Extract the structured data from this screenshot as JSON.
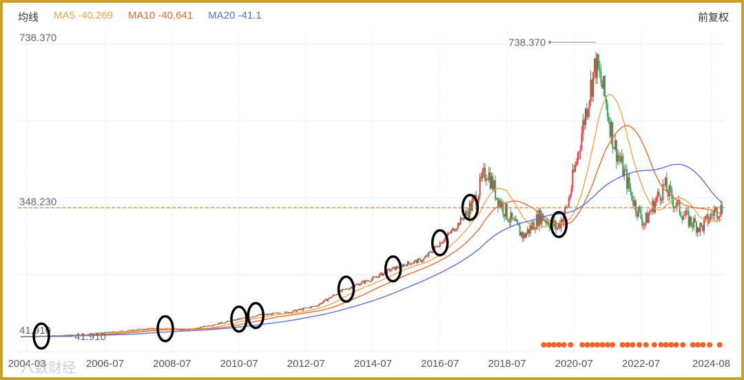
{
  "header": {
    "indicator_label": "均线",
    "ma5_label": "MA5 -40.269",
    "ma10_label": "MA10 -40.641",
    "ma20_label": "MA20 -41.1",
    "adjust_label": "前复权"
  },
  "colors": {
    "up": "#e8383b",
    "down": "#21a95c",
    "ma5": "#f0a64a",
    "ma10": "#ea6a2c",
    "ma20": "#5a6fd8",
    "dashed_line": "#ea7a30",
    "event_dot": "#f0642a",
    "circle": "#000000",
    "frame": "#c9a12a"
  },
  "watermark": "八数财经",
  "chart_data": {
    "type": "candlestick",
    "title": "",
    "xlabel": "",
    "ylabel": "",
    "y_ticks": [
      "738.370",
      "348.230",
      "41.910"
    ],
    "y_tick_values": [
      738.37,
      348.23,
      41.91
    ],
    "max_label": "738.370",
    "start_label": "41.910",
    "current_price_line": 348.23,
    "x_ticks": [
      "2004-03",
      "2006-07",
      "2008-07",
      "2010-07",
      "2012-07",
      "2014-07",
      "2016-07",
      "2018-07",
      "2020-07",
      "2022-07",
      "2024-08"
    ],
    "x_tick_years": [
      2004.17,
      2006.5,
      2008.5,
      2010.5,
      2012.5,
      2014.5,
      2016.5,
      2018.5,
      2020.5,
      2022.5,
      2024.6
    ],
    "x_range": [
      2003.9,
      2025.0
    ],
    "y_range": [
      6,
      770
    ],
    "price_path": [
      [
        2004.0,
        42
      ],
      [
        2005.0,
        44
      ],
      [
        2006.0,
        48
      ],
      [
        2007.0,
        55
      ],
      [
        2008.0,
        62
      ],
      [
        2009.0,
        58
      ],
      [
        2010.0,
        75
      ],
      [
        2011.0,
        92
      ],
      [
        2012.0,
        100
      ],
      [
        2012.8,
        115
      ],
      [
        2013.5,
        148
      ],
      [
        2014.0,
        165
      ],
      [
        2014.5,
        180
      ],
      [
        2015.0,
        200
      ],
      [
        2015.5,
        215
      ],
      [
        2016.0,
        225
      ],
      [
        2016.5,
        265
      ],
      [
        2017.0,
        305
      ],
      [
        2017.5,
        360
      ],
      [
        2017.9,
        440
      ],
      [
        2018.2,
        375
      ],
      [
        2018.6,
        320
      ],
      [
        2019.0,
        280
      ],
      [
        2019.5,
        330
      ],
      [
        2020.0,
        300
      ],
      [
        2020.3,
        350
      ],
      [
        2020.6,
        470
      ],
      [
        2020.9,
        600
      ],
      [
        2021.15,
        690
      ],
      [
        2021.4,
        620
      ],
      [
        2021.7,
        500
      ],
      [
        2022.0,
        430
      ],
      [
        2022.3,
        360
      ],
      [
        2022.6,
        310
      ],
      [
        2022.9,
        360
      ],
      [
        2023.2,
        400
      ],
      [
        2023.5,
        360
      ],
      [
        2023.9,
        320
      ],
      [
        2024.3,
        300
      ],
      [
        2024.7,
        340
      ],
      [
        2024.95,
        348
      ]
    ],
    "moving_averages": [
      {
        "name": "MA5",
        "window_months": 5
      },
      {
        "name": "MA10",
        "window_months": 10
      },
      {
        "name": "MA20",
        "window_months": 20
      }
    ],
    "highlight_circles_years": [
      2004.6,
      2008.3,
      2010.5,
      2011.0,
      2013.7,
      2015.1,
      2016.5,
      2017.4,
      2020.05
    ],
    "event_dot_years": [
      2019.6,
      2019.75,
      2019.9,
      2020.05,
      2020.2,
      2020.4,
      2020.75,
      2020.9,
      2021.05,
      2021.2,
      2021.35,
      2021.5,
      2021.65,
      2021.95,
      2022.1,
      2022.25,
      2022.45,
      2022.65,
      2022.9,
      2023.1,
      2023.25,
      2023.4,
      2023.55,
      2023.75,
      2024.05,
      2024.2,
      2024.35,
      2024.55,
      2024.85
    ]
  }
}
